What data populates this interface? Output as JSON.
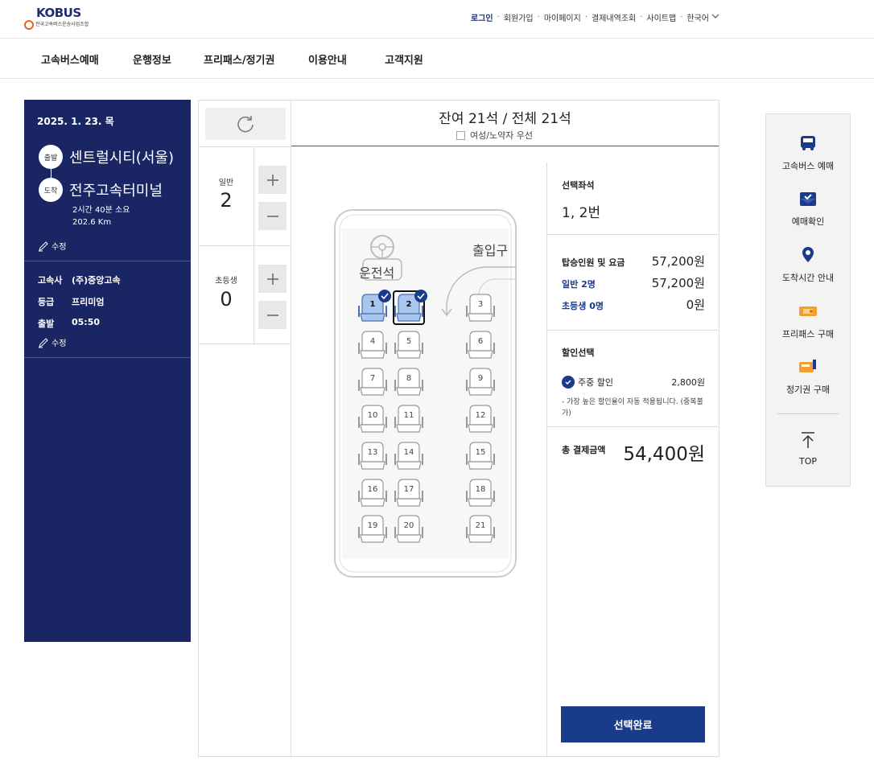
{
  "header": {
    "logo_text": "KOBUS",
    "logo_sub": "전국고속버스운송사업조합",
    "utility": [
      "로그인",
      "회원가입",
      "마이페이지",
      "결제내역조회",
      "사이트맵",
      "한국어"
    ]
  },
  "gnb": [
    "고속버스예매",
    "운행정보",
    "프리패스/정기권",
    "이용안내",
    "고객지원"
  ],
  "trip": {
    "date": "2025. 1. 23. 목",
    "dep_badge": "출발",
    "arr_badge": "도착",
    "departure": "센트럴시티(서울)",
    "arrival": "전주고속터미널",
    "duration": "2시간 40분 소요",
    "distance": "202.6 Km",
    "edit_label": "수정",
    "company_label": "고속사",
    "company": "(주)중앙고속",
    "grade_label": "등급",
    "grade": "프리미엄",
    "depart_label": "출발",
    "depart_time": "05:50"
  },
  "counters": [
    {
      "label": "일반",
      "value": "2"
    },
    {
      "label": "초등생",
      "value": "0"
    }
  ],
  "seat_header": {
    "title": "잔여 21석 / 전체 21석",
    "legend": "여성/노약자 우선"
  },
  "bus": {
    "driver_label": "운전석",
    "exit_label": "출입구",
    "seats": [
      "1",
      "2",
      "3",
      "4",
      "5",
      "6",
      "7",
      "8",
      "9",
      "10",
      "11",
      "12",
      "13",
      "14",
      "15",
      "16",
      "17",
      "18",
      "19",
      "20",
      "21"
    ],
    "selected": [
      "1",
      "2"
    ]
  },
  "summary": {
    "selected_title": "선택좌석",
    "selected_seats": "1, 2번",
    "fare_title": "탑승인원 및 요금",
    "fare_total": "57,200원",
    "adult_label": "일반 2명",
    "adult_fare": "57,200원",
    "child_label": "초등생 0명",
    "child_fare": "0원",
    "discount_title": "할인선택",
    "discount_name": "주중 할인",
    "discount_amount": "2,800원",
    "discount_note": "- 가장 높은 할인율이 자동 적용됩니다. (중복불가)",
    "total_label": "총 결제금액",
    "total_value": "54,400원",
    "complete_button": "선택완료"
  },
  "quick_menu": [
    {
      "label": "고속버스 예매",
      "icon": "bus-icon"
    },
    {
      "label": "예매확인",
      "icon": "ticket-check-icon"
    },
    {
      "label": "도착시간 안내",
      "icon": "location-pin-icon"
    },
    {
      "label": "프리패스 구매",
      "icon": "freepass-icon"
    },
    {
      "label": "정기권 구매",
      "icon": "season-ticket-icon"
    },
    {
      "label": "TOP",
      "icon": "arrow-up-icon"
    }
  ],
  "colors": {
    "navy": "#1a2664",
    "accent": "#1a3a8a",
    "seat_selected": "#a9c6ef"
  }
}
